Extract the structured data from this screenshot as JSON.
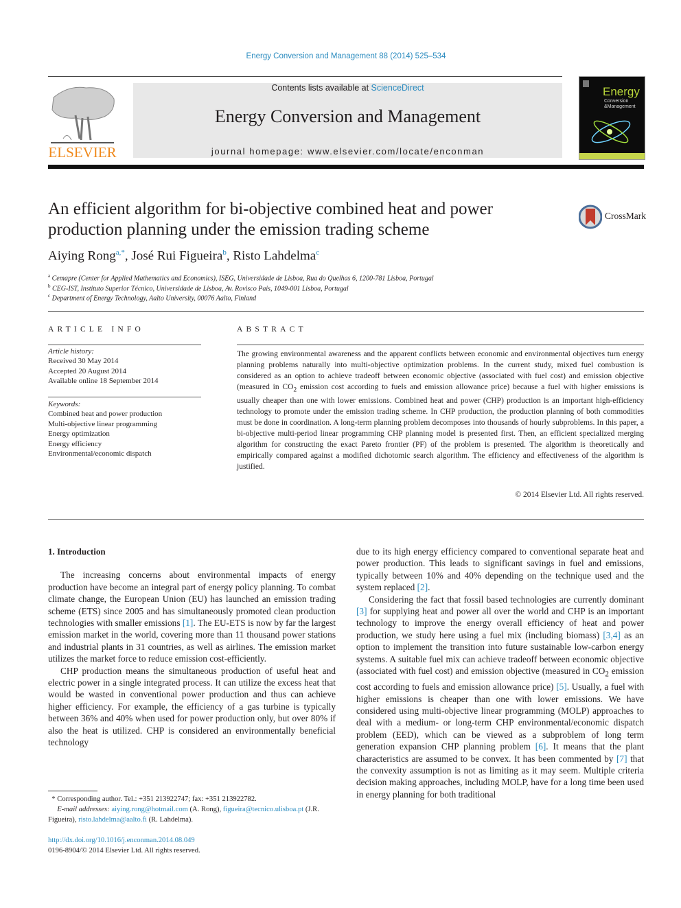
{
  "header": {
    "citation": "Energy Conversion and Management 88 (2014) 525–534",
    "contents_prefix": "Contents lists available at ",
    "contents_link": "ScienceDirect",
    "journal_title": "Energy Conversion and Management",
    "homepage": "journal homepage: www.elsevier.com/locate/enconman",
    "publisher_logo": "ELSEVIER",
    "cover": {
      "title": "Energy",
      "subtitle_1": "Conversion",
      "subtitle_2": "&Management"
    },
    "link_color": "#2a8bbf",
    "publisher_color": "#f08a1d"
  },
  "article": {
    "title": "An efficient algorithm for bi-objective combined heat and power production planning under the emission trading scheme",
    "crossmark": "CrossMark",
    "authors": [
      {
        "name": "Aiying Rong",
        "sup": "a,*"
      },
      {
        "name": "José Rui Figueira",
        "sup": "b"
      },
      {
        "name": "Risto Lahdelma",
        "sup": "c"
      }
    ],
    "affiliations": [
      {
        "key": "a",
        "text": "Cemapre (Center for Applied Mathematics and Economics), ISEG, Universidade de Lisboa, Rua do Quelhas 6, 1200-781 Lisboa, Portugal"
      },
      {
        "key": "b",
        "text": "CEG-IST, Instituto Superior Técnico, Universidade de Lisboa, Av. Rovisco Pais, 1049-001 Lisboa, Portugal"
      },
      {
        "key": "c",
        "text": "Department of Energy Technology, Aalto University, 00076 Aalto, Finland"
      }
    ]
  },
  "article_info": {
    "heading": "ARTICLE INFO",
    "history_label": "Article history:",
    "history": [
      "Received 30 May 2014",
      "Accepted 20 August 2014",
      "Available online 18 September 2014"
    ],
    "keywords_label": "Keywords:",
    "keywords": [
      "Combined heat and power production",
      "Multi-objective linear programming",
      "Energy optimization",
      "Energy efficiency",
      "Environmental/economic dispatch"
    ]
  },
  "abstract": {
    "heading": "ABSTRACT",
    "text_1": "The growing environmental awareness and the apparent conflicts between economic and environmental objectives turn energy planning problems naturally into multi-objective optimization problems. In the current study, mixed fuel combustion is considered as an option to achieve tradeoff between economic objective (associated with fuel cost) and emission objective (measured in CO",
    "sub": "2",
    "text_2": " emission cost according to fuels and emission allowance price) because a fuel with higher emissions is usually cheaper than one with lower emissions. Combined heat and power (CHP) production is an important high-efficiency technology to promote under the emission trading scheme. In CHP production, the production planning of both commodities must be done in coordination. A long-term planning problem decomposes into thousands of hourly subproblems. In this paper, a bi-objective multi-period linear programming CHP planning model is presented first. Then, an efficient specialized merging algorithm for constructing the exact Pareto frontier (PF) of the problem is presented. The algorithm is theoretically and empirically compared against a modified dichotomic search algorithm. The efficiency and effectiveness of the algorithm is justified.",
    "copyright": "© 2014 Elsevier Ltd. All rights reserved."
  },
  "body": {
    "section_heading": "1. Introduction",
    "left": {
      "p1_a": "The increasing concerns about environmental impacts of energy production have become an integral part of energy policy planning. To combat climate change, the European Union (EU) has launched an emission trading scheme (ETS) since 2005 and has simultaneously promoted clean production technologies with smaller emissions ",
      "ref1": "[1]",
      "p1_b": ". The EU-ETS is now by far the largest emission market in the world, covering more than 11 thousand power stations and industrial plants in 31 countries, as well as airlines. The emission market utilizes the market force to reduce emission cost-efficiently.",
      "p2": "CHP production means the simultaneous production of useful heat and electric power in a single integrated process. It can utilize the excess heat that would be wasted in conventional power production and thus can achieve higher efficiency. For example, the efficiency of a gas turbine is typically between 36% and 40% when used for power production only, but over 80% if also the heat is utilized. CHP is considered an environmentally beneficial technology"
    },
    "right": {
      "p1_a": "due to its high energy efficiency compared to conventional separate heat and power production. This leads to significant savings in fuel and emissions, typically between 10% and 40% depending on the technique used and the system replaced ",
      "ref2": "[2]",
      "p1_b": ".",
      "p2_a": "Considering the fact that fossil based technologies are currently dominant ",
      "ref3": "[3]",
      "p2_b": " for supplying heat and power all over the world and CHP is an important technology to improve the energy overall efficiency of heat and power production, we study here using a fuel mix (including biomass) ",
      "ref34": "[3,4]",
      "p2_c": " as an option to implement the transition into future sustainable low-carbon energy systems. A suitable fuel mix can achieve tradeoff between economic objective (associated with fuel cost) and emission objective (measured in CO",
      "sub": "2",
      "p2_d": " emission cost according to fuels and emission allowance price) ",
      "ref5": "[5]",
      "p2_e": ". Usually, a fuel with higher emissions is cheaper than one with lower emissions. We have considered using multi-objective linear programming (MOLP) approaches to deal with a medium- or long-term CHP environmental/economic dispatch problem (EED), which can be viewed as a subproblem of long term generation expansion CHP planning problem ",
      "ref6": "[6]",
      "p2_f": ". It means that the plant characteristics are assumed to be convex. It has been commented by ",
      "ref7": "[7]",
      "p2_g": " that the convexity assumption is not as limiting as it may seem. Multiple criteria decision making approaches, including MOLP, have for a long time been used in energy planning for both traditional"
    }
  },
  "footnote": {
    "star": "*",
    "corresponding": "Corresponding author. Tel.: +351 213922747; fax: +351 213922782.",
    "email_label": "E-mail addresses: ",
    "email1": "aiying.rong@hotmail.com",
    "email1_who": " (A. Rong), ",
    "email2": "figueira@tecnico.ulisboa.pt",
    "email2_who": " (J.R. Figueira), ",
    "email3": "risto.lahdelma@aalto.fi",
    "email3_who": " (R. Lahdelma).",
    "doi": "http://dx.doi.org/10.1016/j.enconman.2014.08.049",
    "issn": "0196-8904/© 2014 Elsevier Ltd. All rights reserved."
  }
}
